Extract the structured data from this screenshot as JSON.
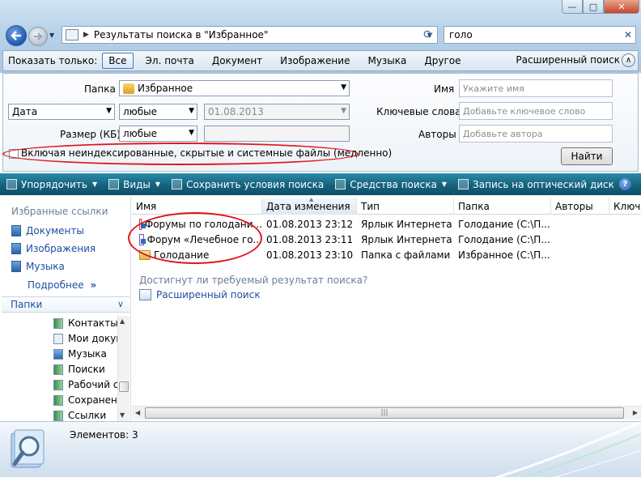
{
  "address": {
    "path_text": "Результаты поиска в \"Избранное\""
  },
  "search": {
    "query": "голо"
  },
  "show_only_bar": {
    "label": "Показать только:",
    "filters": [
      "Все",
      "Эл. почта",
      "Документ",
      "Изображение",
      "Музыка",
      "Другое"
    ],
    "active_filter": "Все",
    "advanced_label": "Расширенный поиск"
  },
  "advanced_pane": {
    "folder_label": "Папка",
    "folder_value": "Избранное",
    "date_type": "Дата",
    "date_condition": "любые",
    "date_value": "01.08.2013",
    "size_label": "Размер (КБ)",
    "size_condition": "любые",
    "include_label": "Включая неиндексированные, скрытые и системные файлы (медленно)",
    "include_checked": false,
    "name_label": "Имя",
    "name_placeholder": "Укажите имя",
    "tags_label": "Ключевые слова",
    "tags_placeholder": "Добавьте ключевое слово",
    "authors_label": "Авторы",
    "authors_placeholder": "Добавьте автора",
    "find_button": "Найти"
  },
  "command_bar": {
    "organize": "Упорядочить",
    "views": "Виды",
    "save_search": "Сохранить условия поиска",
    "search_tools": "Средства поиска",
    "burn": "Запись на оптический диск"
  },
  "nav_pane": {
    "favorites_header": "Избранные ссылки",
    "favorites": [
      "Документы",
      "Изображения",
      "Музыка"
    ],
    "more_label": "Подробнее",
    "folders_label": "Папки",
    "tree": [
      {
        "label": "Контакты",
        "icon": "contacts-icon"
      },
      {
        "label": "Мои докум",
        "icon": "shortcut-icon"
      },
      {
        "label": "Музыка",
        "icon": "music-icon"
      },
      {
        "label": "Поиски",
        "icon": "searches-icon"
      },
      {
        "label": "Рабочий с",
        "icon": "desktop-icon"
      },
      {
        "label": "Сохранен",
        "icon": "saved-games-icon"
      },
      {
        "label": "Ссылки",
        "icon": "links-icon"
      }
    ]
  },
  "file_list": {
    "columns": [
      "Имя",
      "Дата изменения",
      "Тип",
      "Папка",
      "Авторы",
      "Ключ"
    ],
    "sorted_column": "Дата изменения",
    "rows": [
      {
        "name": "Форумы по голодани...",
        "modified": "01.08.2013 23:12",
        "type": "Ярлык Интернета",
        "folder": "Голодание (C:\\П...",
        "icon": "internet-shortcut-icon"
      },
      {
        "name": "Форум «Лечебное го...",
        "modified": "01.08.2013 23:11",
        "type": "Ярлык Интернета",
        "folder": "Голодание (C:\\П...",
        "icon": "internet-shortcut-icon"
      },
      {
        "name": "Голодание",
        "modified": "01.08.2013 23:10",
        "type": "Папка с файлами",
        "folder": "Избранное (C:\\П...",
        "icon": "folder-icon"
      }
    ],
    "hint": "Достигнут ли требуемый результат поиска?",
    "advanced_link": "Расширенный поиск"
  },
  "details_pane": {
    "items_label": "Элементов: 3"
  },
  "colors": {
    "command_bar": "#15627d",
    "link": "#1d4fa0",
    "annotation_red": "#e0161f"
  }
}
